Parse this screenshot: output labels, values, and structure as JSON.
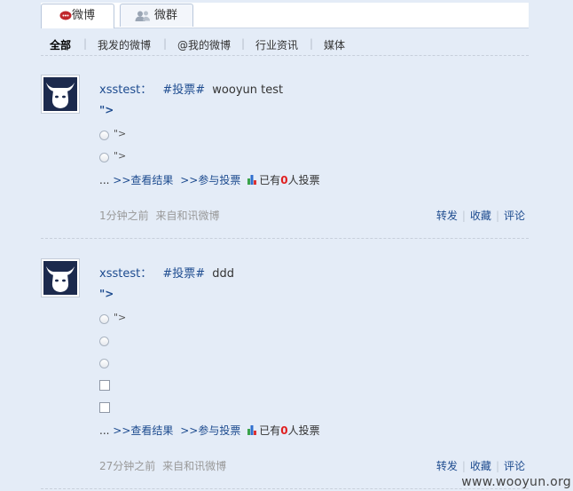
{
  "tabs": [
    {
      "label": "微博"
    },
    {
      "label": "微群"
    }
  ],
  "subnav": {
    "items": [
      "全部",
      "我发的微博",
      "@我的微博",
      "行业资讯",
      "媒体"
    ],
    "separator": "|"
  },
  "posts": [
    {
      "user": "xsstest：",
      "tag": "#投票#",
      "text": "wooyun test",
      "quote": "\">",
      "options": [
        {
          "type": "radio",
          "text": "\">"
        },
        {
          "type": "radio",
          "text": "\">"
        }
      ],
      "ellipsis": "...",
      "view_results": ">>查看结果",
      "join_vote": ">>参与投票",
      "vote_prefix": "已有",
      "vote_count": "0",
      "vote_suffix": "人投票",
      "time": "1分钟之前",
      "source": "来自和讯微博",
      "actions": [
        "转发",
        "收藏",
        "评论"
      ]
    },
    {
      "user": "xsstest：",
      "tag": "#投票#",
      "text": "ddd",
      "quote": "\">",
      "options": [
        {
          "type": "radio",
          "text": "\">"
        },
        {
          "type": "radio",
          "text": ""
        },
        {
          "type": "radio",
          "text": ""
        },
        {
          "type": "checkbox",
          "text": ""
        },
        {
          "type": "checkbox",
          "text": ""
        }
      ],
      "ellipsis": "...",
      "view_results": ">>查看结果",
      "join_vote": ">>参与投票",
      "vote_prefix": "已有",
      "vote_count": "0",
      "vote_suffix": "人投票",
      "time": "27分钟之前",
      "source": "来自和讯微博",
      "actions": [
        "转发",
        "收藏",
        "评论"
      ]
    }
  ],
  "watermark": "www.wooyun.org"
}
